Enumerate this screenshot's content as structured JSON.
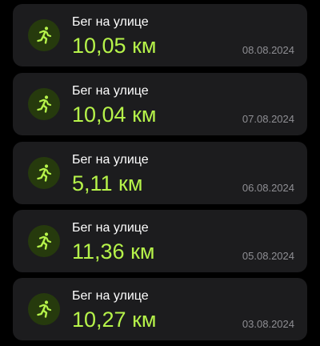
{
  "colors": {
    "background": "#000000",
    "card": "#1c1c1e",
    "accent": "#b6f34a",
    "icon_bg": "#263a0d",
    "title": "#ffffff",
    "date": "#8e8e93"
  },
  "workouts": [
    {
      "icon": "running-icon",
      "title": "Бег на улице",
      "distance": "10,05 км",
      "date": "08.08.2024"
    },
    {
      "icon": "running-icon",
      "title": "Бег на улице",
      "distance": "10,04 км",
      "date": "07.08.2024"
    },
    {
      "icon": "running-icon",
      "title": "Бег на улице",
      "distance": "5,11 км",
      "date": "06.08.2024"
    },
    {
      "icon": "running-icon",
      "title": "Бег на улице",
      "distance": "11,36 км",
      "date": "05.08.2024"
    },
    {
      "icon": "running-icon",
      "title": "Бег на улице",
      "distance": "10,27 км",
      "date": "03.08.2024"
    }
  ]
}
